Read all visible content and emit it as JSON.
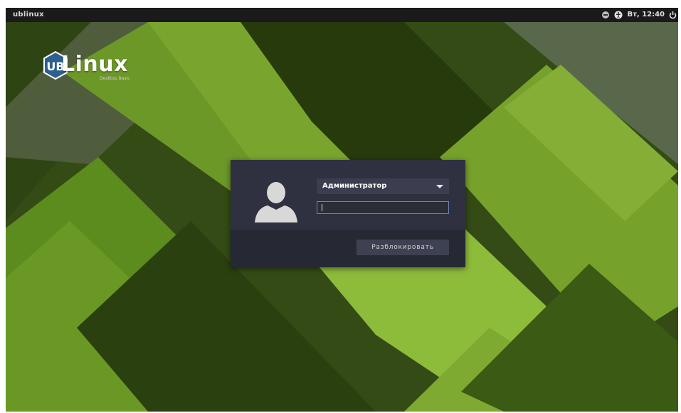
{
  "topbar": {
    "hostname": "ublinux",
    "clock": "Вт, 12:40",
    "icons": [
      "network-icon",
      "accessibility-icon",
      "power-icon"
    ]
  },
  "logo": {
    "badge": "UB",
    "name": "Linux",
    "subtitle": "Desktop Basic"
  },
  "login": {
    "username": "Администратор",
    "password_value": "",
    "unlock_label": "Разблокировать"
  },
  "colors": {
    "panel": "#1a1a1c",
    "dialog": "#2f3140",
    "dialog_footer": "#262834",
    "field_border": "#6e82b8",
    "wallpaper_green": "#5f8a22"
  }
}
